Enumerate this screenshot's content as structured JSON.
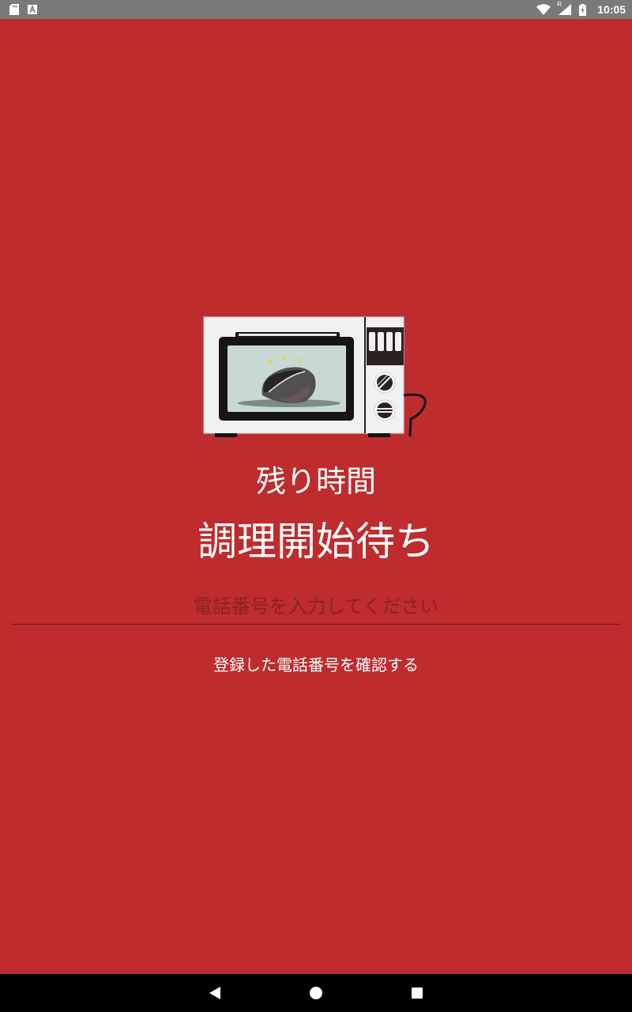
{
  "status_bar": {
    "time": "10:05",
    "left_icons": [
      "sd-card-icon",
      "font-a-icon"
    ],
    "right_icons": [
      "wifi-icon",
      "cell-signal-icon",
      "battery-charging-icon"
    ],
    "roaming_mark": "R"
  },
  "main": {
    "illustration": "microwave-illustration",
    "remaining_label": "残り時間",
    "status_text": "調理開始待ち",
    "phone_input": {
      "value": "",
      "placeholder": "電話番号を入力してください"
    },
    "confirm_link": "登録した電話番号を確認する"
  },
  "nav_bar": {
    "buttons": [
      "back",
      "home",
      "recents"
    ]
  },
  "colors": {
    "background": "#be2c2e",
    "status_bar": "#7a7a7a",
    "nav_bar": "#000000",
    "placeholder": "#8d2224"
  }
}
